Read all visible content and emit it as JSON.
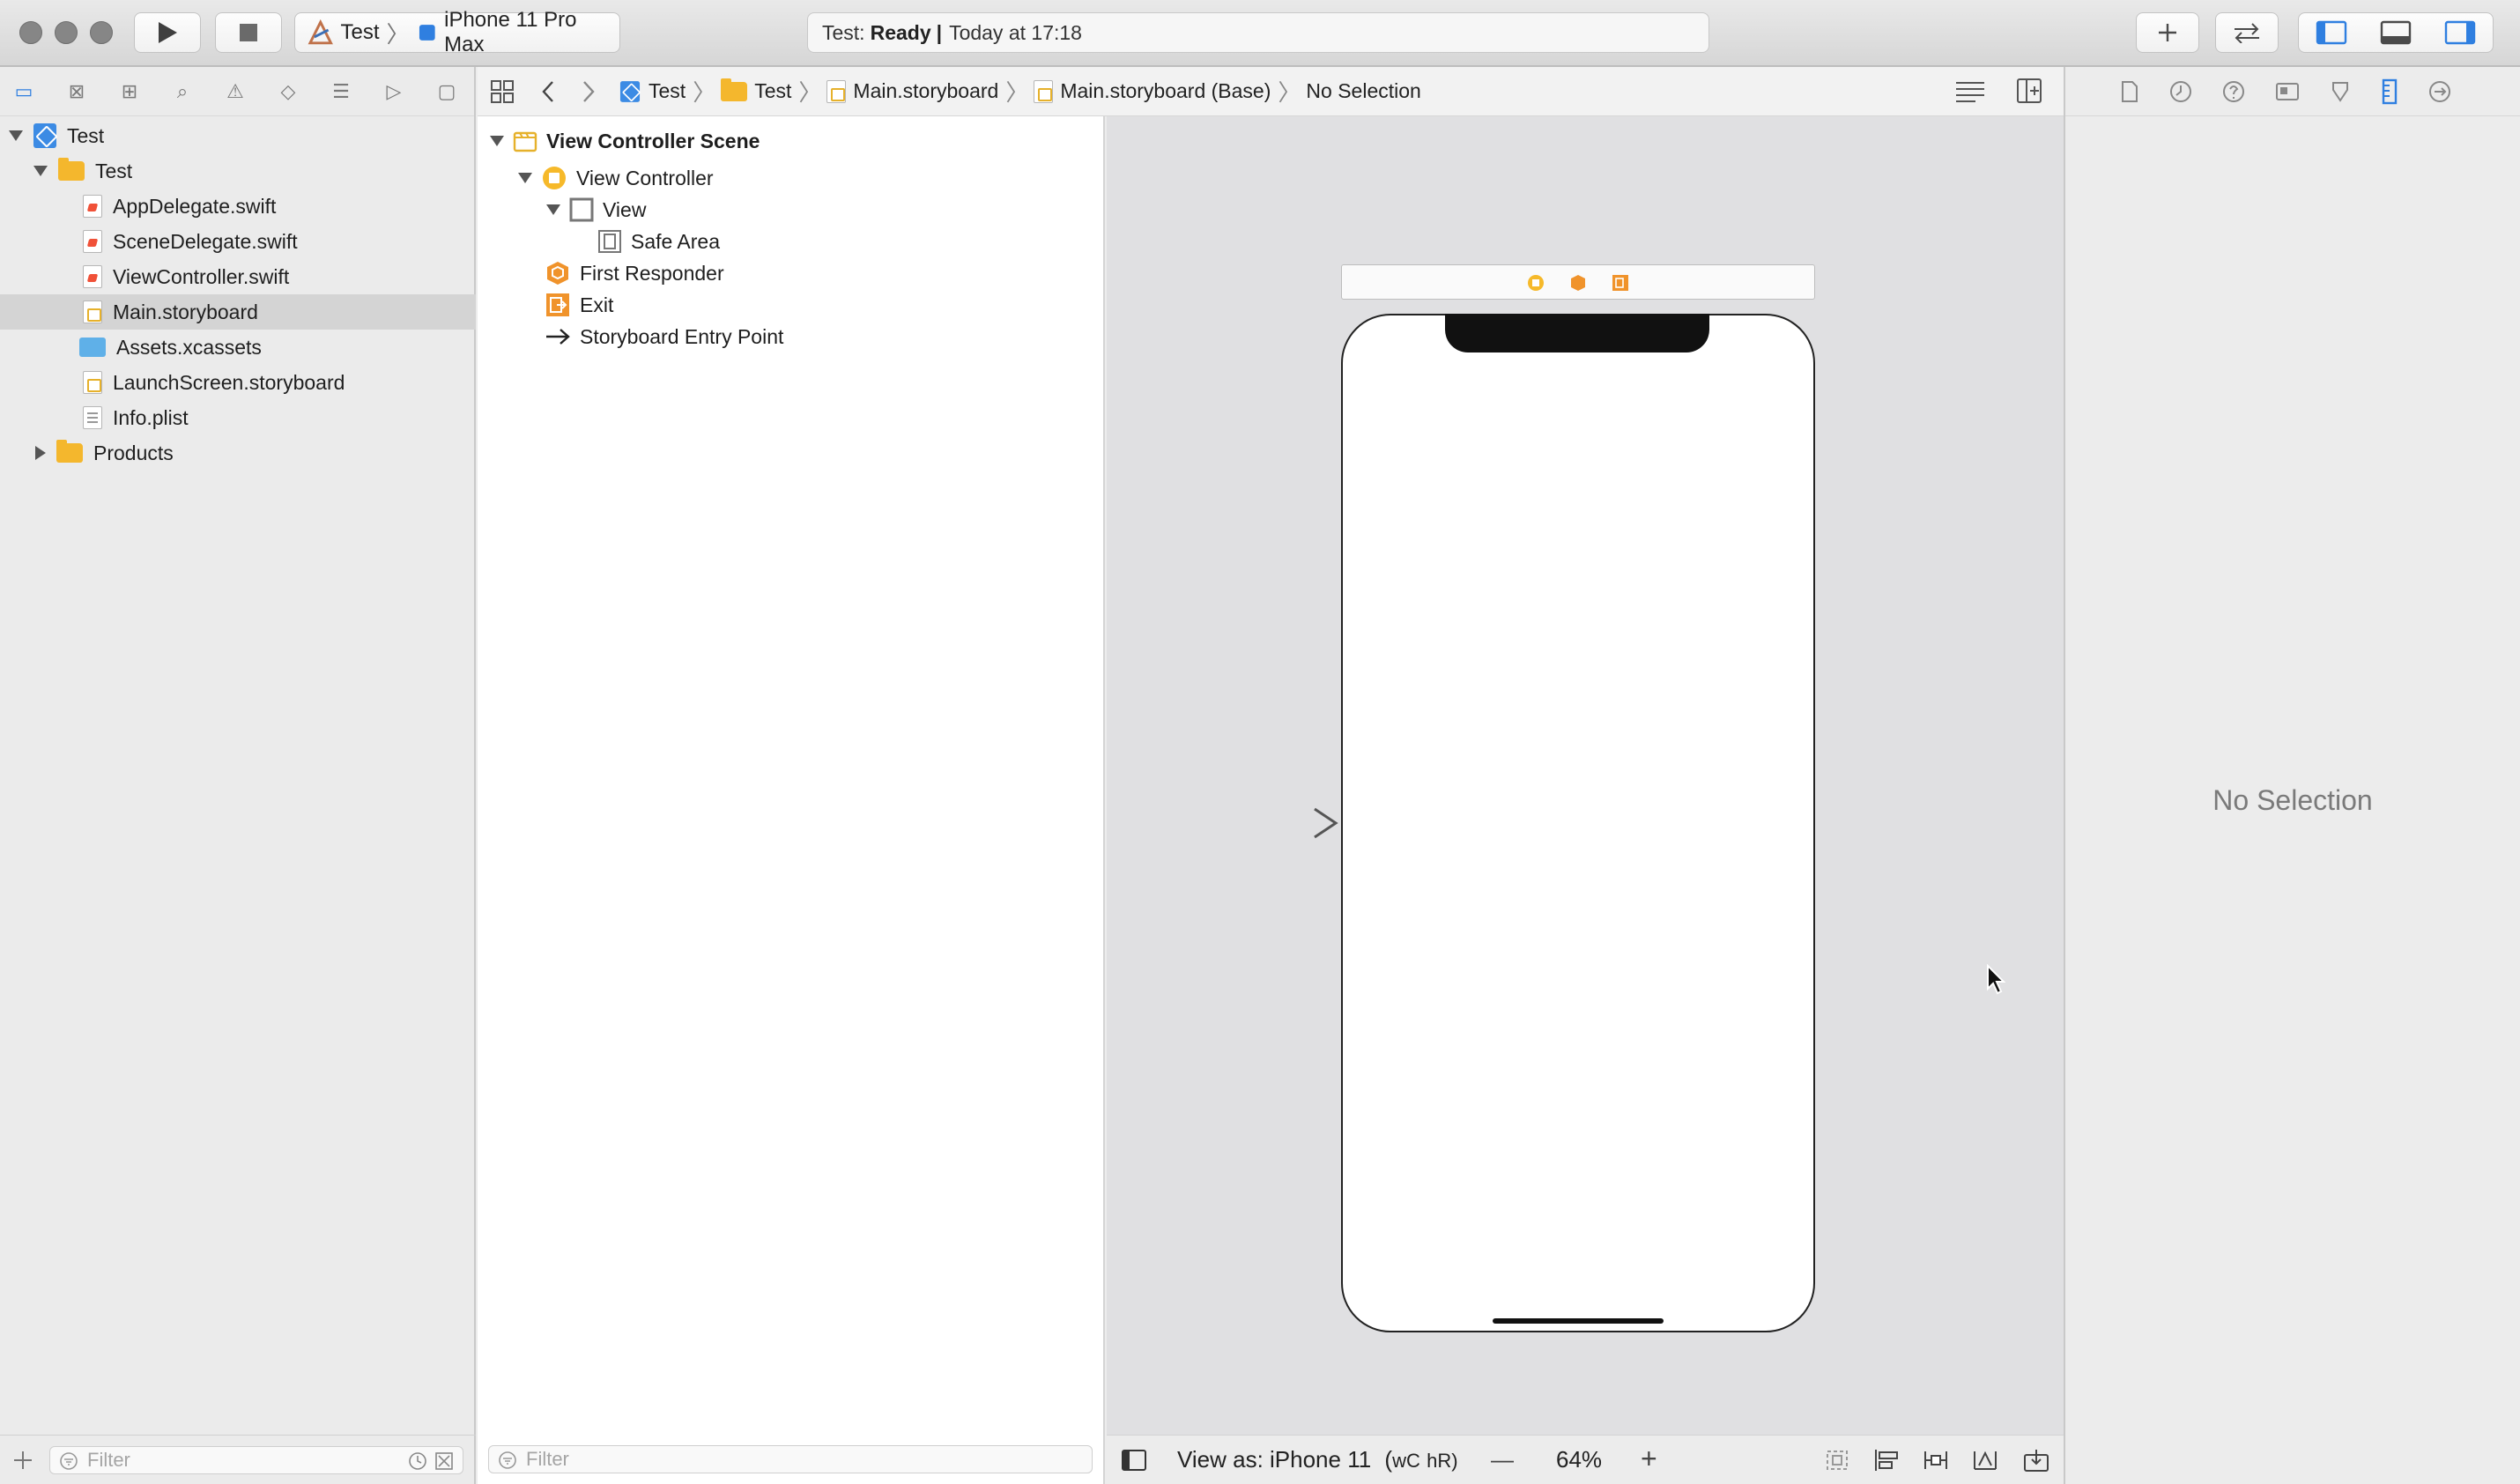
{
  "toolbar": {
    "scheme_target": "Test",
    "scheme_device": "iPhone 11 Pro Max",
    "activity_prefix": "Test:",
    "activity_status": "Ready",
    "activity_sep": "|",
    "activity_time": "Today at 17:18",
    "run_icon": "play-icon",
    "stop_icon": "stop-icon",
    "add_icon": "plus-icon",
    "review_icon": "swap-arrows-icon"
  },
  "navigator": {
    "tabs": [
      "folder-icon",
      "source-control-icon",
      "hierarchy-icon",
      "search-icon",
      "warning-icon",
      "test-icon",
      "debug-icon",
      "breakpoint-icon",
      "report-icon"
    ],
    "items": [
      {
        "label": "Test",
        "kind": "project"
      },
      {
        "label": "Test",
        "kind": "folder"
      },
      {
        "label": "AppDelegate.swift",
        "kind": "swift"
      },
      {
        "label": "SceneDelegate.swift",
        "kind": "swift"
      },
      {
        "label": "ViewController.swift",
        "kind": "swift"
      },
      {
        "label": "Main.storyboard",
        "kind": "storyboard"
      },
      {
        "label": "Assets.xcassets",
        "kind": "assets"
      },
      {
        "label": "LaunchScreen.storyboard",
        "kind": "storyboard"
      },
      {
        "label": "Info.plist",
        "kind": "plist"
      },
      {
        "label": "Products",
        "kind": "folder"
      }
    ],
    "filter_placeholder": "Filter"
  },
  "jumpbar": {
    "crumbs": [
      "Test",
      "Test",
      "Main.storyboard",
      "Main.storyboard (Base)",
      "No Selection"
    ]
  },
  "outline": {
    "rows": [
      {
        "label": "View Controller Scene"
      },
      {
        "label": "View Controller"
      },
      {
        "label": "View"
      },
      {
        "label": "Safe Area"
      },
      {
        "label": "First Responder"
      },
      {
        "label": "Exit"
      },
      {
        "label": "Storyboard Entry Point"
      }
    ],
    "filter_placeholder": "Filter"
  },
  "canvas": {
    "view_as": "View as: iPhone 11",
    "size_class_w": "wC",
    "size_class_h": "hR)",
    "size_class_open": "(",
    "zoom": "64%",
    "zoom_out": "—",
    "zoom_in": "+"
  },
  "inspector": {
    "tabs": [
      "file-icon",
      "history-icon",
      "help-icon",
      "identity-icon",
      "attributes-icon",
      "size-icon",
      "connections-icon"
    ],
    "empty_text": "No Selection"
  },
  "colors": {
    "accent": "#3c8be4",
    "swift": "#f05138",
    "storyboard": "#e6b12b",
    "folder": "#f4b72d",
    "entry_orange": "#f0932b"
  }
}
